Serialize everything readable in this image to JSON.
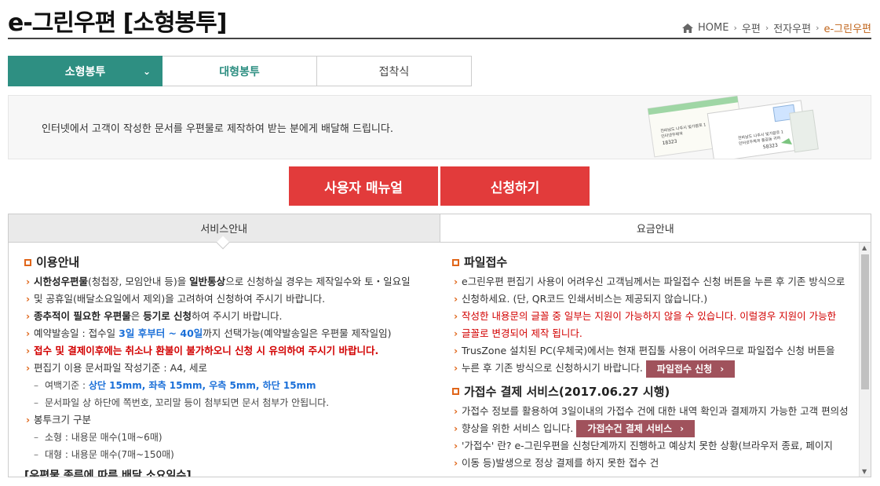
{
  "page": {
    "title": "e-그린우편 [소형봉투]"
  },
  "breadcrumb": {
    "home": "HOME",
    "level1": "우편",
    "level2": "전자우편",
    "current": "e-그린우편"
  },
  "tabs": [
    {
      "label": "소형봉투"
    },
    {
      "label": "대형봉투"
    },
    {
      "label": "접착식"
    }
  ],
  "banner": {
    "text": "인터넷에서 고객이 작성한 문서를 우편물로 제작하여 받는 분에게 배달해 드립니다.",
    "art": {
      "addr1": "전라남도 나주시 빛가람로 1",
      "addr2": "인터넷우체국",
      "code1": "18323",
      "addr3": "전라남도 나주시 빛가람로 1",
      "addr4": "인터넷우체국 홍길동 귀하",
      "code2": "58323"
    }
  },
  "buttons": {
    "manual": "사용자 매뉴얼",
    "apply": "신청하기"
  },
  "content_tabs": {
    "service": "서비스안내",
    "fee": "요금안내"
  },
  "left": {
    "usage_title": "이용안내",
    "i1a": "시한성우편물",
    "i1b": "(청첩장, 모임안내 등)을 ",
    "i1c": "일반통상",
    "i1d": "으로 신청하실 경우는 제작일수와 토・일요일",
    "i1e": "및 공휴일(배달소요일에서 제외)을 고려하여 신청하여 주시기 바랍니다.",
    "i2a": "종추적이 필요한 우편물",
    "i2b": "은 ",
    "i2c": "등기로 신청",
    "i2d": "하여 주시기 바랍니다.",
    "i3a": "예약발송일 : 접수일 ",
    "i3b": "3일 후부터 ~ 40일",
    "i3c": "까지 선택가능(예약발송일은 우편물 제작일임)",
    "i4": "접수 및 결제이후에는 취소나 환불이 불가하오니 신청 시 유의하여 주시기 바랍니다.",
    "i5": "편집기 이용 문서파일 작성기준 : A4, 세로",
    "s1a": "여백기준 : ",
    "s1b": "상단 15mm, 좌측 15mm, 우측 5mm, 하단 15mm",
    "s2": "문서파일 상 하단에 쪽번호, 꼬리말 등이 첨부되면 문서 첨부가 안됩니다.",
    "i6": "봉투크기 구분",
    "s3": "소형 : 내용문 매수(1매~6매)",
    "s4": "대형 : 내용문 매수(7매~150매)",
    "cut": "[우편물 종류에 따른 배달 소요일수]"
  },
  "right": {
    "file_title": "파일접수",
    "f1": "e그린우편 편집기 사용이 어려우신 고객님께서는 파일접수 신청 버튼을 누른 후 기존 방식으로",
    "f1b": "신청하세요. (단, QR코드 인쇄서비스는 제공되지 않습니다.)",
    "f2": "작성한 내용문의 글꼴 중 일부는 지원이 가능하지 않을 수 있습니다. 이럴경우 지원이 가능한",
    "f2b": "글꼴로 변경되어 제작 됩니다.",
    "f3": "TrusZone 설치된 PC(우체국)에서는 현재 편집툴 사용이 어려우므로 파일접수 신청 버튼을",
    "f3b": "누른 후 기존 방식으로 신청하시기 바랍니다.",
    "file_btn": "파일접수 신청",
    "pay_title": "가접수 결제 서비스(2017.06.27 시행)",
    "p1": "가접수 정보를 활용하여 3일이내의 가접수 건에 대한 내역 확인과 결제까지 가능한 고객 편의성",
    "p1b": "향상을 위한 서비스 입니다.",
    "pay_btn": "가접수건 결제 서비스",
    "p2": "'가접수' 란? e-그린우편을 신청단계까지 진행하고 예상치 못한 상황(브라우저 종료, 페이지",
    "p2b": "이동 등)발생으로 정상 결제를 하지 못한 접수 건"
  },
  "colors": {
    "accent": "#2e8f82",
    "red_button": "#e23b3b",
    "mini_button": "#a0525c",
    "bullet": "#e0661a"
  }
}
